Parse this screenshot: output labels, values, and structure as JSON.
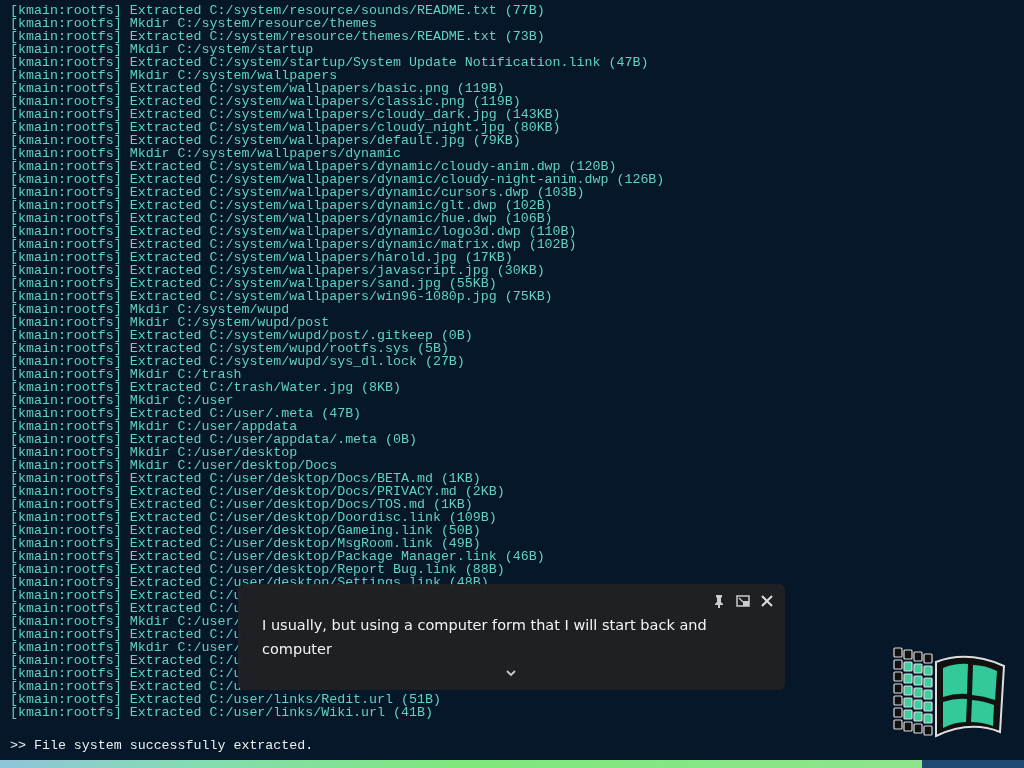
{
  "terminal": {
    "lines": [
      "[kmain:rootfs] Extracted C:/system/resource/sounds/README.txt (77B)",
      "[kmain:rootfs] Mkdir C:/system/resource/themes",
      "[kmain:rootfs] Extracted C:/system/resource/themes/README.txt (73B)",
      "[kmain:rootfs] Mkdir C:/system/startup",
      "[kmain:rootfs] Extracted C:/system/startup/System Update Notification.link (47B)",
      "[kmain:rootfs] Mkdir C:/system/wallpapers",
      "[kmain:rootfs] Extracted C:/system/wallpapers/basic.png (119B)",
      "[kmain:rootfs] Extracted C:/system/wallpapers/classic.png (119B)",
      "[kmain:rootfs] Extracted C:/system/wallpapers/cloudy_dark.jpg (143KB)",
      "[kmain:rootfs] Extracted C:/system/wallpapers/cloudy_night.jpg (80KB)",
      "[kmain:rootfs] Extracted C:/system/wallpapers/default.jpg (79KB)",
      "[kmain:rootfs] Mkdir C:/system/wallpapers/dynamic",
      "[kmain:rootfs] Extracted C:/system/wallpapers/dynamic/cloudy-anim.dwp (120B)",
      "[kmain:rootfs] Extracted C:/system/wallpapers/dynamic/cloudy-night-anim.dwp (126B)",
      "[kmain:rootfs] Extracted C:/system/wallpapers/dynamic/cursors.dwp (103B)",
      "[kmain:rootfs] Extracted C:/system/wallpapers/dynamic/glt.dwp (102B)",
      "[kmain:rootfs] Extracted C:/system/wallpapers/dynamic/hue.dwp (106B)",
      "[kmain:rootfs] Extracted C:/system/wallpapers/dynamic/logo3d.dwp (110B)",
      "[kmain:rootfs] Extracted C:/system/wallpapers/dynamic/matrix.dwp (102B)",
      "[kmain:rootfs] Extracted C:/system/wallpapers/harold.jpg (17KB)",
      "[kmain:rootfs] Extracted C:/system/wallpapers/javascript.jpg (30KB)",
      "[kmain:rootfs] Extracted C:/system/wallpapers/sand.jpg (55KB)",
      "[kmain:rootfs] Extracted C:/system/wallpapers/win96-1080p.jpg (75KB)",
      "[kmain:rootfs] Mkdir C:/system/wupd",
      "[kmain:rootfs] Mkdir C:/system/wupd/post",
      "[kmain:rootfs] Extracted C:/system/wupd/post/.gitkeep (0B)",
      "[kmain:rootfs] Extracted C:/system/wupd/rootfs.sys (5B)",
      "[kmain:rootfs] Extracted C:/system/wupd/sys_dl.lock (27B)",
      "[kmain:rootfs] Mkdir C:/trash",
      "[kmain:rootfs] Extracted C:/trash/Water.jpg (8KB)",
      "[kmain:rootfs] Mkdir C:/user",
      "[kmain:rootfs] Extracted C:/user/.meta (47B)",
      "[kmain:rootfs] Mkdir C:/user/appdata",
      "[kmain:rootfs] Extracted C:/user/appdata/.meta (0B)",
      "[kmain:rootfs] Mkdir C:/user/desktop",
      "[kmain:rootfs] Mkdir C:/user/desktop/Docs",
      "[kmain:rootfs] Extracted C:/user/desktop/Docs/BETA.md (1KB)",
      "[kmain:rootfs] Extracted C:/user/desktop/Docs/PRIVACY.md (2KB)",
      "[kmain:rootfs] Extracted C:/user/desktop/Docs/TOS.md (1KB)",
      "[kmain:rootfs] Extracted C:/user/desktop/Doordisc.link (109B)",
      "[kmain:rootfs] Extracted C:/user/desktop/Gameing.link (50B)",
      "[kmain:rootfs] Extracted C:/user/desktop/MsgRoom.link (49B)",
      "[kmain:rootfs] Extracted C:/user/desktop/Package Manager.link (46B)",
      "[kmain:rootfs] Extracted C:/user/desktop/Report Bug.link (88B)",
      "[kmain:rootfs] Extracted C:/user/desktop/Settings.link (48B)",
      "[kmain:rootfs] Extracted C:/u",
      "[kmain:rootfs] Extracted C:/u",
      "[kmain:rootfs] Mkdir C:/user/",
      "[kmain:rootfs] Extracted C:/u",
      "[kmain:rootfs] Mkdir C:/user/",
      "[kmain:rootfs] Extracted C:/u",
      "[kmain:rootfs] Extracted C:/u",
      "[kmain:rootfs] Extracted C:/u",
      "[kmain:rootfs] Extracted C:/user/links/Redit.url (51B)",
      "[kmain:rootfs] Extracted C:/user/links/Wiki.url (41B)"
    ],
    "prompt": ">> File system successfully extracted."
  },
  "progress": {
    "level": 0.9
  },
  "caption_window": {
    "text": "I usually, but using a computer form that I will start back and computer"
  }
}
